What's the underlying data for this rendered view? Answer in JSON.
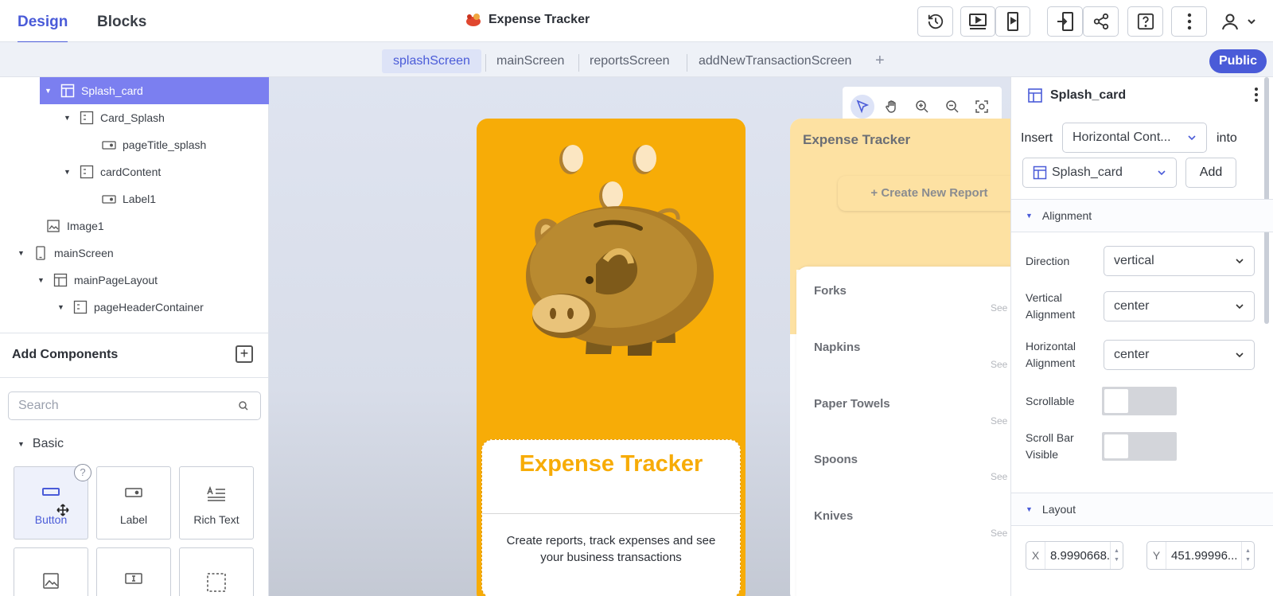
{
  "top_tabs": [
    {
      "label": "Design"
    },
    {
      "label": "Blocks"
    }
  ],
  "app_title": "Expense Tracker",
  "toolbar_icons": [
    "history-icon",
    "preview-icon",
    "device-preview-icon",
    "export-icon",
    "share-icon",
    "help-icon",
    "more-vertical-icon",
    "user-icon"
  ],
  "screen_tabs": [
    {
      "label": "splashScreen",
      "active": true
    },
    {
      "label": "mainScreen"
    },
    {
      "label": "reportsScreen"
    },
    {
      "label": "addNewTransactionScreen"
    }
  ],
  "add_screen_label": "+",
  "public_label": "Public",
  "tree": [
    {
      "label": "Splash_card",
      "selected": true
    },
    {
      "label": "Card_Splash"
    },
    {
      "label": "pageTitle_splash"
    },
    {
      "label": "cardContent"
    },
    {
      "label": "Label1"
    },
    {
      "label": "Image1"
    },
    {
      "label": "mainScreen"
    },
    {
      "label": "mainPageLayout"
    },
    {
      "label": "pageHeaderContainer"
    }
  ],
  "add_components": {
    "title": "Add Components",
    "search_placeholder": "Search",
    "basic_label": "Basic",
    "help_badge": "?",
    "tiles": [
      {
        "label": "Button"
      },
      {
        "label": "Label"
      },
      {
        "label": "Rich Text"
      }
    ]
  },
  "splash_preview": {
    "title": "Expense Tracker",
    "description": "Create reports, track expenses and see your business transactions"
  },
  "main_preview": {
    "title": "Expense Tracker",
    "create_button": "+ Create New Report",
    "items": [
      "Forks",
      "Napkins",
      "Paper Towels",
      "Spoons",
      "Knives"
    ],
    "see_text": "See Re"
  },
  "properties": {
    "component_name": "Splash_card",
    "insert_label": "Insert",
    "insert_value": "Horizontal Cont...",
    "into_label": "into",
    "target_value": "Splash_card",
    "add_button": "Add",
    "alignment_section": "Alignment",
    "direction_label": "Direction",
    "direction_value": "vertical",
    "vertical_label": "Vertical Alignment",
    "vertical_value": "center",
    "horizontal_label": "Horizontal Alignment",
    "horizontal_value": "center",
    "scrollable_label": "Scrollable",
    "scrollbar_visible_label": "Scroll Bar Visible",
    "layout_section": "Layout",
    "x_label": "X",
    "x_value": "8.9990668...",
    "y_label": "Y",
    "y_value": "451.99996..."
  },
  "colors": {
    "accent": "#4a5bd8",
    "splash_bg": "#f7ac07",
    "selection": "#7b7ff0"
  }
}
